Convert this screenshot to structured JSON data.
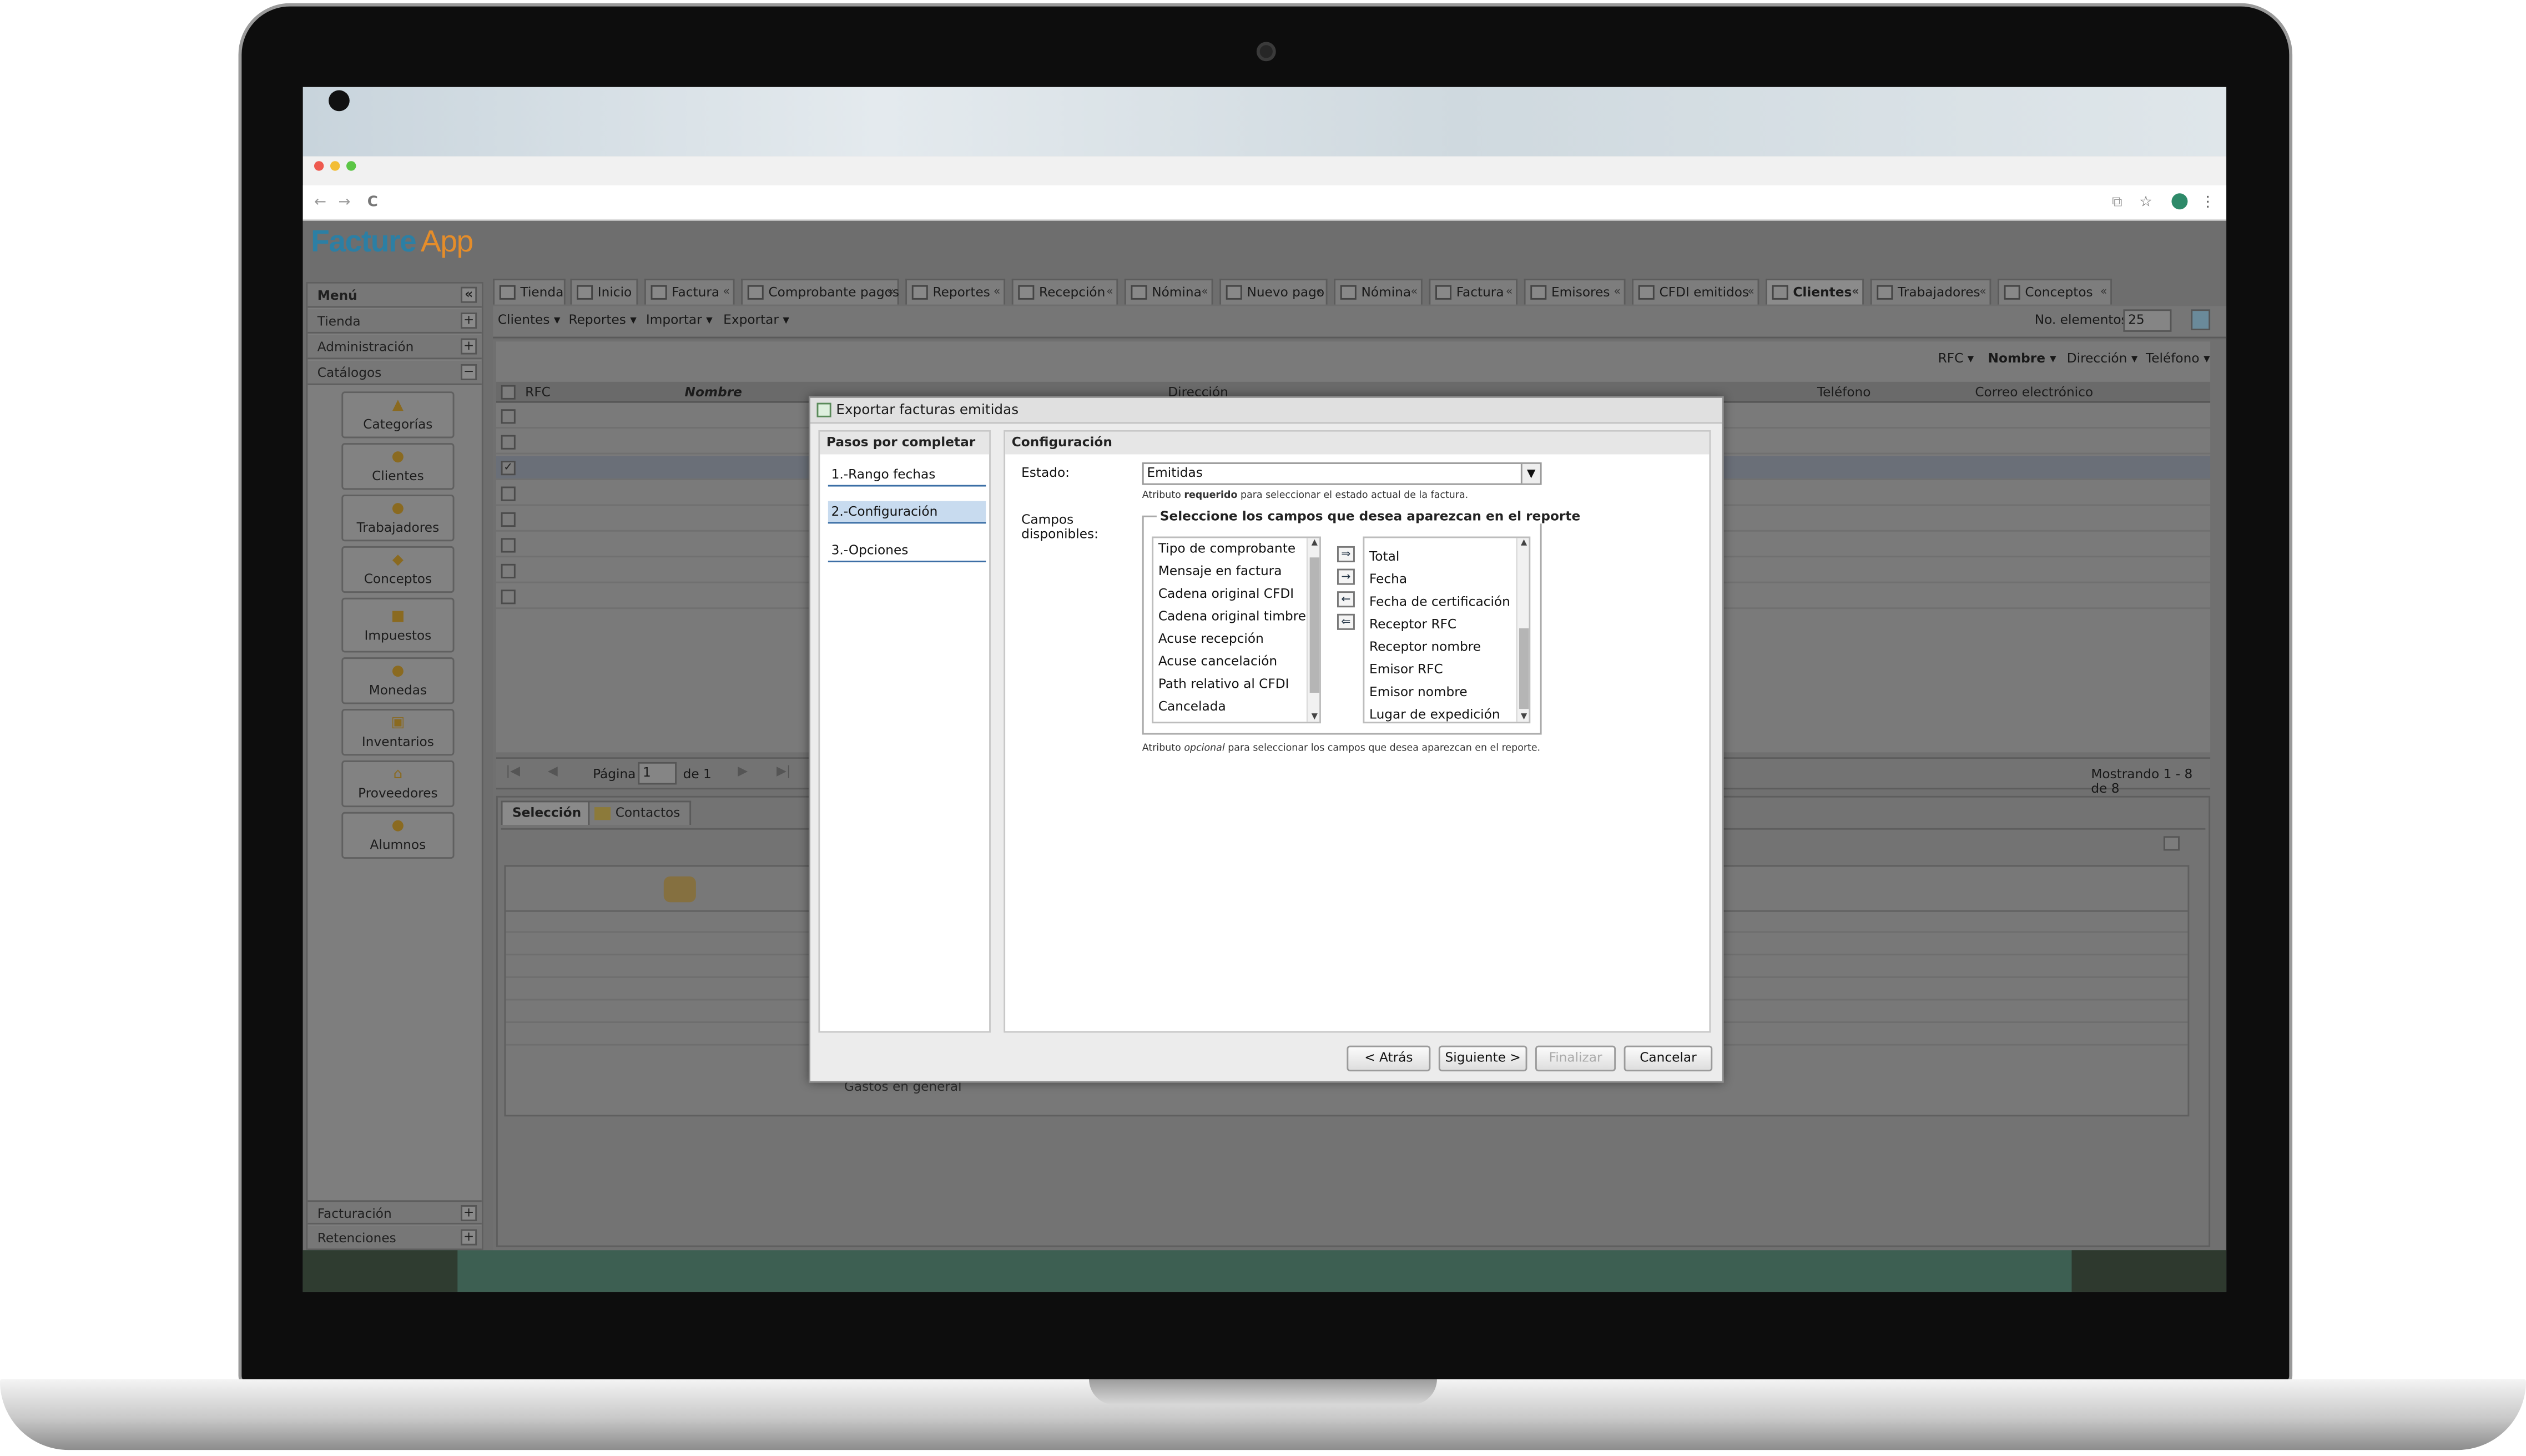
{
  "browser": {
    "nav_back": "←",
    "nav_forward": "→",
    "reload": "C",
    "translate_icon": "⧉",
    "star_icon": "☆",
    "menu_icon": "⋮"
  },
  "app": {
    "logo_primary": "Facture",
    "logo_secondary": "App"
  },
  "sidebar": {
    "header": "Menú",
    "collapse": "«",
    "sections": [
      {
        "label": "Tienda",
        "toggle": "+"
      },
      {
        "label": "Administración",
        "toggle": "+"
      },
      {
        "label": "Catálogos",
        "toggle": "−"
      }
    ],
    "catalogs": [
      {
        "label": "Categorías",
        "icon": "categories-icon"
      },
      {
        "label": "Clientes",
        "icon": "clients-icon"
      },
      {
        "label": "Trabajadores",
        "icon": "workers-icon"
      },
      {
        "label": "Conceptos",
        "icon": "concepts-icon"
      },
      {
        "label": "Impuestos",
        "icon": "taxes-icon"
      },
      {
        "label": "Monedas",
        "icon": "coins-icon"
      },
      {
        "label": "Inventarios",
        "icon": "inventory-icon"
      },
      {
        "label": "Proveedores",
        "icon": "suppliers-icon"
      },
      {
        "label": "Alumnos",
        "icon": "students-icon"
      }
    ],
    "bottom_sections": [
      {
        "label": "Facturación",
        "toggle": "+"
      },
      {
        "label": "Retenciones",
        "toggle": "+"
      }
    ]
  },
  "tabs": [
    {
      "label": "Tienda"
    },
    {
      "label": "Inicio"
    },
    {
      "label": "Factura"
    },
    {
      "label": "Comprobante pagos"
    },
    {
      "label": "Reportes"
    },
    {
      "label": "Recepción"
    },
    {
      "label": "Nómina"
    },
    {
      "label": "Nuevo pago"
    },
    {
      "label": "Nómina"
    },
    {
      "label": "Factura"
    },
    {
      "label": "Emisores"
    },
    {
      "label": "CFDI emitidos"
    },
    {
      "label": "Clientes",
      "active": true
    },
    {
      "label": "Trabajadores"
    },
    {
      "label": "Conceptos"
    }
  ],
  "tab_close": "«",
  "toolbar": {
    "clientes": "Clientes ▾",
    "reportes": "Reportes ▾",
    "importar": "Importar ▾",
    "exportar": "Exportar ▾",
    "no_elementos_label": "No. elementos",
    "no_elementos_value": "25"
  },
  "sortbar": {
    "rfc": "RFC ▾",
    "nombre": "Nombre ▾",
    "direccion": "Dirección ▾",
    "telefono": "Teléfono ▾"
  },
  "grid": {
    "columns": [
      "RFC",
      "Nombre",
      "Dirección",
      "Teléfono",
      "Correo electrónico"
    ],
    "rows": 8,
    "checked_row": 3
  },
  "pager": {
    "page_label": "Página",
    "page_value": "1",
    "of": "de 1",
    "showing": "Mostrando 1 - 8 de 8"
  },
  "lower": {
    "tab_seleccion": "Selección",
    "tab_contactos": "Contactos",
    "footer_text": "Gastos en general"
  },
  "dialog": {
    "title": "Exportar facturas emitidas",
    "steps_header": "Pasos por completar",
    "steps": [
      "1.-Rango fechas",
      "2.-Configuración",
      "3.-Opciones"
    ],
    "config_header": "Configuración",
    "estado_label": "Estado:",
    "estado_value": "Emitidas",
    "estado_hint_pre": "Atributo ",
    "estado_hint_bold": "requerido",
    "estado_hint_post": " para seleccionar el estado actual de la factura.",
    "campos_label": "Campos disponibles:",
    "fieldset_legend": "Seleccione los campos que desea aparezcan en el reporte",
    "available": [
      "Tipo de comprobante",
      "Mensaje en factura",
      "Cadena original CFDI",
      "Cadena original timbre",
      "Acuse recepción",
      "Acuse cancelación",
      "Path relativo al CFDI",
      "Cancelada"
    ],
    "selected": [
      "Total",
      "Fecha",
      "Fecha de certificación",
      "Receptor RFC",
      "Receptor nombre",
      "Emisor RFC",
      "Emisor nombre",
      "Lugar de expedición"
    ],
    "move_buttons": [
      "⇒",
      "→",
      "←",
      "⇐"
    ],
    "campos_hint_pre": "Atributo ",
    "campos_hint_italic": "opcional",
    "campos_hint_post": " para seleccionar los campos que desea aparezcan en el reporte.",
    "buttons": {
      "back": "< Atrás",
      "next": "Siguiente >",
      "finish": "Finalizar",
      "cancel": "Cancelar"
    }
  },
  "colors": {
    "logo_blue": "#2c7fa4",
    "logo_orange": "#e58d2a",
    "step_selected": "#c8dbef",
    "modal_overlay": "#6e6e6e"
  }
}
